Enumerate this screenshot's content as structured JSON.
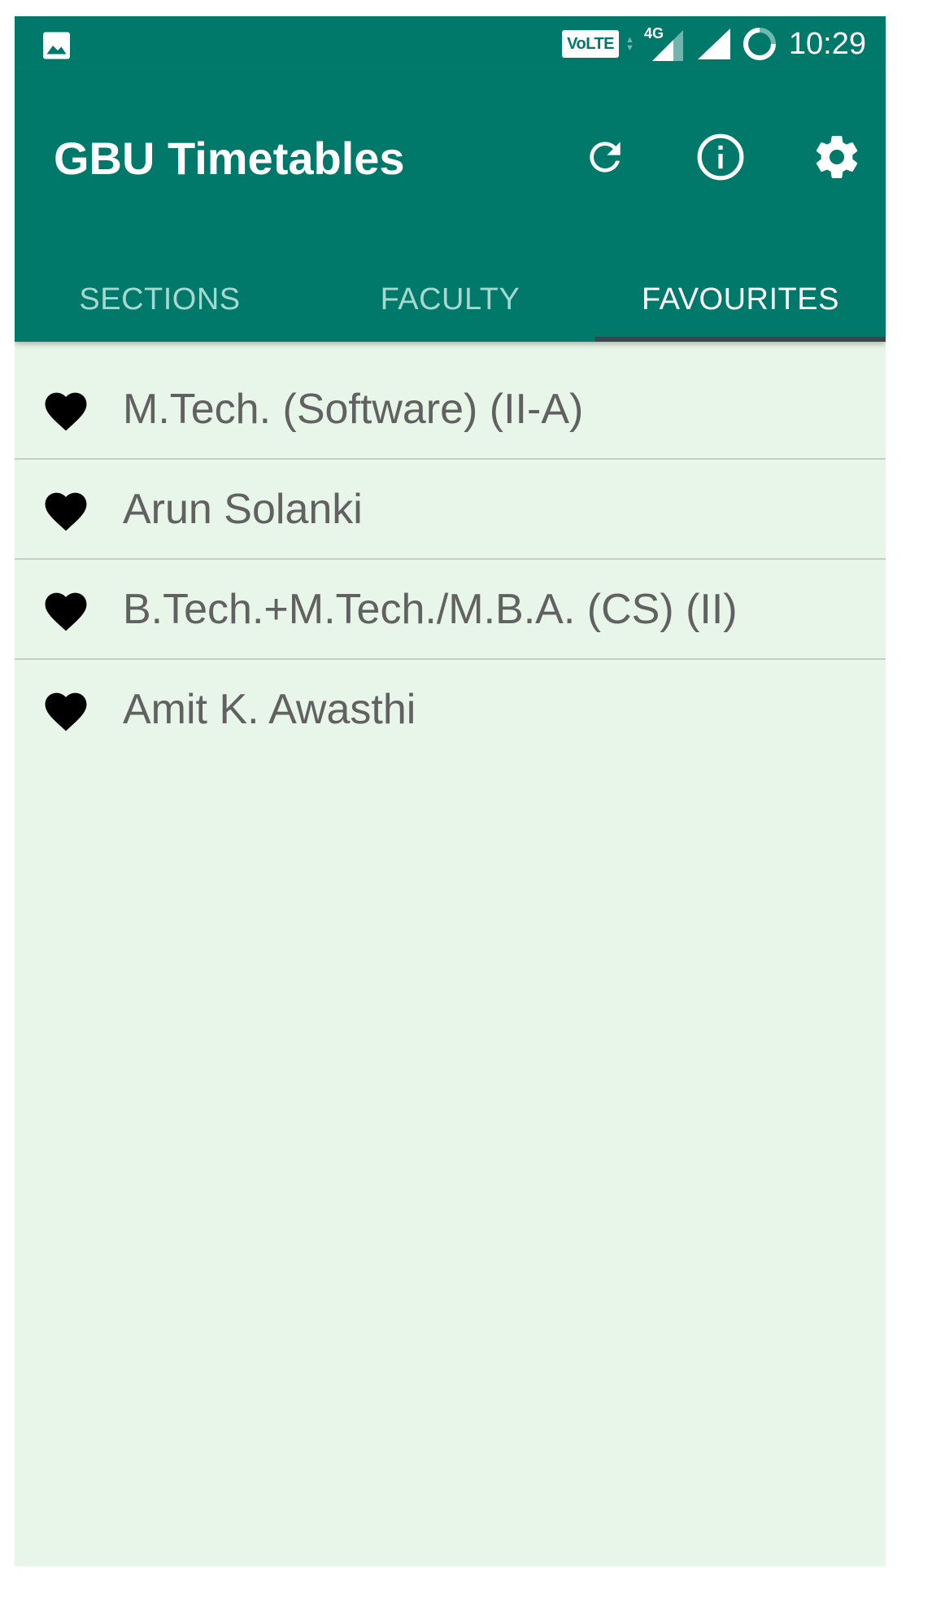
{
  "status_bar": {
    "volte": "VoLTE",
    "network": "4G",
    "time": "10:29"
  },
  "app_bar": {
    "title": "GBU Timetables",
    "actions": [
      "refresh-icon",
      "info-icon",
      "settings-icon"
    ]
  },
  "tabs": [
    {
      "label": "SECTIONS",
      "active": false
    },
    {
      "label": "FACULTY",
      "active": false
    },
    {
      "label": "FAVOURITES",
      "active": true
    }
  ],
  "favourites": [
    {
      "label": "M.Tech. (Software) (II-A)",
      "icon": "heart-icon"
    },
    {
      "label": "Arun Solanki",
      "icon": "heart-icon"
    },
    {
      "label": "B.Tech.+M.Tech./M.B.A. (CS) (II)",
      "icon": "heart-icon"
    },
    {
      "label": "Amit K. Awasthi",
      "icon": "heart-icon"
    }
  ],
  "colors": {
    "primary": "#00796b",
    "background": "#e8f5e9",
    "tab_inactive": "#a7d8d0",
    "tab_indicator": "#37474f",
    "list_text": "#616161"
  }
}
